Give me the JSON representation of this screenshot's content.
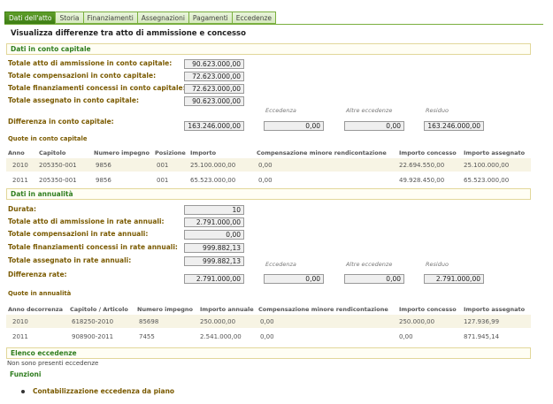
{
  "tabs": [
    "Dati dell'atto",
    "Storia",
    "Finanziamenti",
    "Assegnazioni",
    "Pagamenti",
    "Eccedenze"
  ],
  "title": "Visualizza differenze tra atto di ammissione e concesso",
  "capitale": {
    "header": "Dati in conto capitale",
    "totale_atto_label": "Totale atto di ammissione in conto capitale:",
    "totale_atto": "90.623.000,00",
    "totale_comp_label": "Totale compensazioni  in conto capitale:",
    "totale_comp": "72.623.000,00",
    "totale_fin_label": "Totale finanziamenti concessi in conto capitale:",
    "totale_fin": "72.623.000,00",
    "totale_ass_label": "Totale assegnato in conto capitale:",
    "totale_ass": "90.623.000,00",
    "col_eccedenza": "Eccedenza",
    "col_altre": "Altre eccedenze",
    "col_residuo": "Residuo",
    "diff_label": "Differenza in conto capitale:",
    "diff": "163.246.000,00",
    "eccedenza": "0,00",
    "altre": "0,00",
    "residuo": "163.246.000,00",
    "quote_header": "Quote in conto capitale",
    "columns": [
      "Anno",
      "Capitolo",
      "Numero impegno",
      "Posizione",
      "Importo",
      "Compensazione minore rendicontazione",
      "Importo concesso",
      "Importo assegnato"
    ],
    "rows": [
      {
        "anno": "2010",
        "capitolo": "205350-001",
        "impegno": "9856",
        "posizione": "001",
        "importo": "25.100.000,00",
        "comp": "0,00",
        "concesso": "22.694.550,00",
        "assegnato": "25.100.000,00"
      },
      {
        "anno": "2011",
        "capitolo": "205350-001",
        "impegno": "9856",
        "posizione": "001",
        "importo": "65.523.000,00",
        "comp": "0,00",
        "concesso": "49.928.450,00",
        "assegnato": "65.523.000,00"
      }
    ]
  },
  "annualita": {
    "header": "Dati in annualità",
    "durata_label": "Durata:",
    "durata": "10",
    "totale_atto_label": "Totale atto di ammissione in rate annuali:",
    "totale_atto": "2.791.000,00",
    "totale_comp_label": "Totale compensazioni in rate annuali:",
    "totale_comp": "0,00",
    "totale_fin_label": "Totale finanziamenti concessi in rate annuali:",
    "totale_fin": "999.882,13",
    "totale_ass_label": "Totale assegnato in rate annuali:",
    "totale_ass": "999.882,13",
    "col_eccedenza": "Eccedenza",
    "col_altre": "Altre eccedenze",
    "col_residuo": "Residuo",
    "diff_label": "Differenza rate:",
    "diff": "2.791.000,00",
    "eccedenza": "0,00",
    "altre": "0,00",
    "residuo": "2.791.000,00",
    "quote_header": "Quote in annualità",
    "columns": [
      "Anno decorrenza",
      "Capitolo / Articolo",
      "Numero impegno",
      "Importo annuale",
      "Compensazione minore rendicontazione",
      "Importo concesso",
      "Importo assegnato"
    ],
    "rows": [
      {
        "anno": "2010",
        "capitolo": "618250-2010",
        "impegno": "85698",
        "importo": "250.000,00",
        "comp": "0,00",
        "concesso": "250.000,00",
        "assegnato": "127.936,99"
      },
      {
        "anno": "2011",
        "capitolo": "908900-2011",
        "impegno": "7455",
        "importo": "2.541.000,00",
        "comp": "0,00",
        "concesso": "0,00",
        "assegnato": "871.945,14"
      }
    ]
  },
  "eccedenze": {
    "header": "Elenco eccedenze",
    "empty": "Non sono presenti eccedenze"
  },
  "funzioni": {
    "header": "Funzioni",
    "link": "Contabilizzazione eccedenza da piano"
  }
}
